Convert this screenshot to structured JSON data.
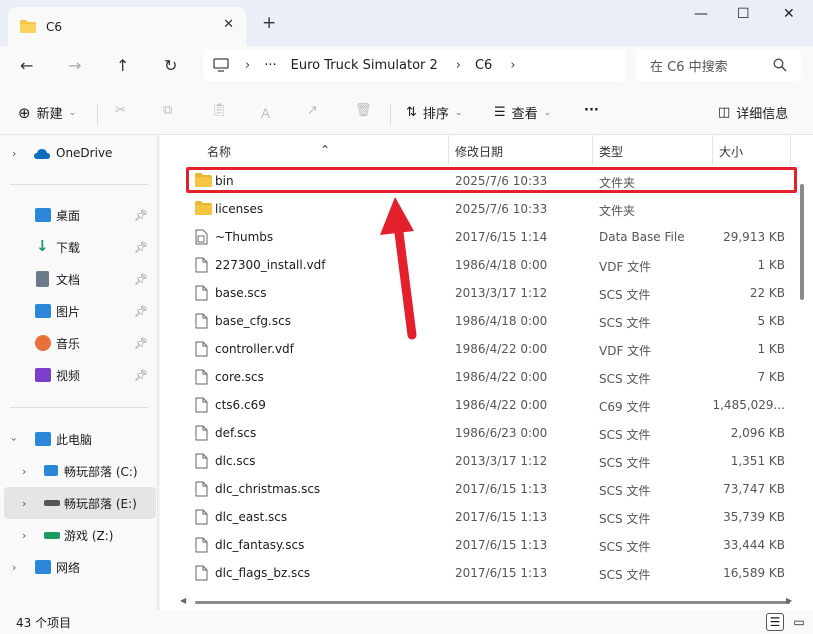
{
  "window": {
    "tab_title": "C6",
    "tab_close": "✕",
    "new_tab": "+",
    "minimize": "—",
    "maximize": "☐",
    "close": "✕"
  },
  "nav": {
    "path": [
      "Euro Truck Simulator 2",
      "C6"
    ],
    "more": "···",
    "search_placeholder": "在 C6 中搜索"
  },
  "toolbar": {
    "new_label": "新建",
    "sort_label": "排序",
    "view_label": "查看",
    "more_label": "···",
    "details_label": "详细信息"
  },
  "sidebar": {
    "items": [
      {
        "label": "OneDrive",
        "icon": "cloud-icon",
        "color": "#0f6cbd"
      },
      {
        "label": "桌面",
        "icon": "desktop-icon",
        "color": "#2b88d8"
      },
      {
        "label": "下载",
        "icon": "download-icon",
        "color": "#1a9a5c"
      },
      {
        "label": "文档",
        "icon": "document-icon",
        "color": "#6b7b8c"
      },
      {
        "label": "图片",
        "icon": "pictures-icon",
        "color": "#2b88d8"
      },
      {
        "label": "音乐",
        "icon": "music-icon",
        "color": "#e8703a"
      },
      {
        "label": "视频",
        "icon": "video-icon",
        "color": "#7a3ec9"
      },
      {
        "label": "此电脑",
        "icon": "computer-icon",
        "color": "#2b88d8"
      },
      {
        "label": "畅玩部落 (C:)",
        "icon": "drive-c-icon",
        "color": "#2b88d8"
      },
      {
        "label": "畅玩部落 (E:)",
        "icon": "drive-e-icon",
        "color": "#555555"
      },
      {
        "label": "游戏 (Z:)",
        "icon": "drive-z-icon",
        "color": "#1a9a5c"
      },
      {
        "label": "网络",
        "icon": "network-icon",
        "color": "#2b88d8"
      }
    ]
  },
  "columns": {
    "name": "名称",
    "date": "修改日期",
    "type": "类型",
    "size": "大小"
  },
  "files": [
    {
      "name": "bin",
      "date": "2025/7/6 10:33",
      "type": "文件夹",
      "size": "",
      "kind": "folder"
    },
    {
      "name": "licenses",
      "date": "2025/7/6 10:33",
      "type": "文件夹",
      "size": "",
      "kind": "folder"
    },
    {
      "name": "~Thumbs",
      "date": "2017/6/15 1:14",
      "type": "Data Base File",
      "size": "29,913 KB",
      "kind": "db"
    },
    {
      "name": "227300_install.vdf",
      "date": "1986/4/18 0:00",
      "type": "VDF 文件",
      "size": "1 KB",
      "kind": "file"
    },
    {
      "name": "base.scs",
      "date": "2013/3/17 1:12",
      "type": "SCS 文件",
      "size": "22 KB",
      "kind": "file"
    },
    {
      "name": "base_cfg.scs",
      "date": "1986/4/18 0:00",
      "type": "SCS 文件",
      "size": "5 KB",
      "kind": "file"
    },
    {
      "name": "controller.vdf",
      "date": "1986/4/22 0:00",
      "type": "VDF 文件",
      "size": "1 KB",
      "kind": "file"
    },
    {
      "name": "core.scs",
      "date": "1986/4/22 0:00",
      "type": "SCS 文件",
      "size": "7 KB",
      "kind": "file"
    },
    {
      "name": "cts6.c69",
      "date": "1986/4/22 0:00",
      "type": "C69 文件",
      "size": "1,485,029...",
      "kind": "file"
    },
    {
      "name": "def.scs",
      "date": "1986/6/23 0:00",
      "type": "SCS 文件",
      "size": "2,096 KB",
      "kind": "file"
    },
    {
      "name": "dlc.scs",
      "date": "2013/3/17 1:12",
      "type": "SCS 文件",
      "size": "1,351 KB",
      "kind": "file"
    },
    {
      "name": "dlc_christmas.scs",
      "date": "2017/6/15 1:13",
      "type": "SCS 文件",
      "size": "73,747 KB",
      "kind": "file"
    },
    {
      "name": "dlc_east.scs",
      "date": "2017/6/15 1:13",
      "type": "SCS 文件",
      "size": "35,739 KB",
      "kind": "file"
    },
    {
      "name": "dlc_fantasy.scs",
      "date": "2017/6/15 1:13",
      "type": "SCS 文件",
      "size": "33,444 KB",
      "kind": "file"
    },
    {
      "name": "dlc_flags_bz.scs",
      "date": "2017/6/15 1:13",
      "type": "SCS 文件",
      "size": "16,589 KB",
      "kind": "file"
    }
  ],
  "status": {
    "item_count": "43 个项目"
  },
  "colors": {
    "highlight": "#e3202c",
    "folder": "#f4c542"
  }
}
